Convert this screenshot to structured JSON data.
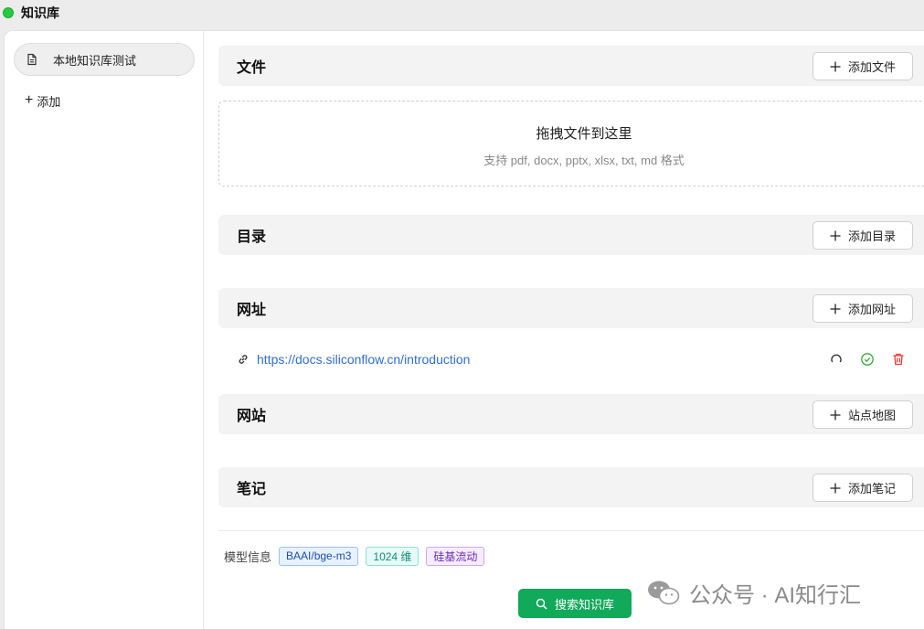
{
  "app": {
    "title": "知识库"
  },
  "sidebar": {
    "items": [
      {
        "label": "本地知识库测试",
        "icon": "document-icon"
      }
    ],
    "add_label": "添加"
  },
  "sections": {
    "files": {
      "title": "文件",
      "button": "添加文件"
    },
    "dropzone": {
      "title": "拖拽文件到这里",
      "subtitle": "支持 pdf, docx, pptx, xlsx, txt, md 格式"
    },
    "directory": {
      "title": "目录",
      "button": "添加目录"
    },
    "urls": {
      "title": "网址",
      "button": "添加网址",
      "items": [
        {
          "url": "https://docs.siliconflow.cn/introduction"
        }
      ]
    },
    "website": {
      "title": "网站",
      "button": "站点地图"
    },
    "notes": {
      "title": "笔记",
      "button": "添加笔记"
    }
  },
  "model_info": {
    "label": "模型信息",
    "tags": [
      {
        "text": "BAAI/bge-m3",
        "color": "#1e4fa8"
      },
      {
        "text": "1024 维",
        "color": "#138a7a"
      },
      {
        "text": "硅基流动",
        "color": "#6b2fb3"
      }
    ]
  },
  "search_button": {
    "label": "搜索知识库"
  },
  "watermark": {
    "text": "公众号 · AI知行汇"
  },
  "colors": {
    "accent_green": "#11a95a",
    "link_blue": "#2f6ed0",
    "success_green": "#3aa63a",
    "danger_red": "#e53935"
  }
}
